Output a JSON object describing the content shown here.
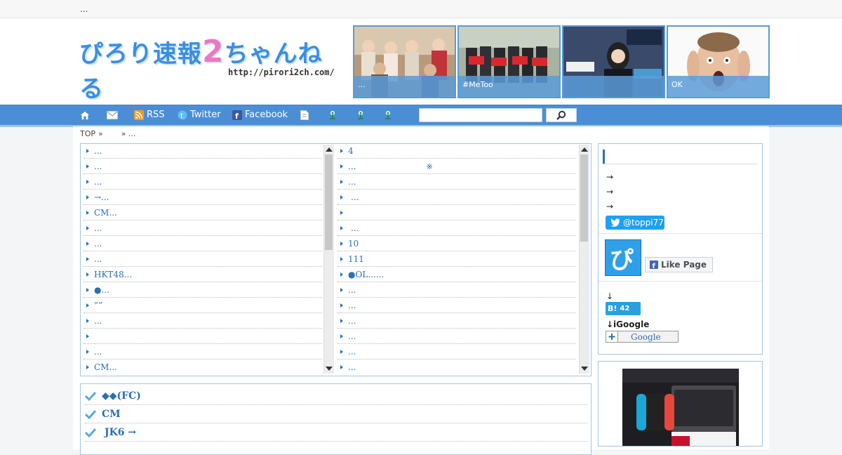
{
  "topbar": {
    "text": "..."
  },
  "header": {
    "logo_text_a": "ぴろり速報",
    "logo_text_2": "2",
    "logo_text_b": "ちゃんねる",
    "logo_url": "http://pirori2ch.com/"
  },
  "thumbs": [
    {
      "caption": "...",
      "icon": "tv-panel-photo"
    },
    {
      "caption": "#MeToo",
      "icon": "protest-photo"
    },
    {
      "caption": "",
      "icon": "news-anchor-photo"
    },
    {
      "caption": "OK",
      "icon": "shocked-man-photo"
    }
  ],
  "nav": {
    "home_icon": "home-icon",
    "mail_icon": "mail-icon",
    "rss": "RSS",
    "twitter": "Twitter",
    "facebook": "Facebook",
    "search_placeholder": ""
  },
  "breadcrumb": {
    "top": "TOP",
    "sep": "»",
    "current": "..."
  },
  "list_left": [
    "...",
    "...",
    "...",
    "→...",
    "CM...",
    "...",
    "...",
    "...",
    "HKT48...",
    "●...",
    "””",
    "...",
    "",
    "...",
    "CM..."
  ],
  "list_right": [
    "4",
    "...",
    "...",
    "...",
    "",
    "...",
    "10",
    "111",
    "●OL......",
    "...",
    "...",
    "...",
    "...",
    "...",
    "..."
  ],
  "list_right_mark": "※",
  "checks": [
    "◆◆(FC)",
    "CM",
    "JK6 →"
  ],
  "sidebar": {
    "arrows": [
      "→",
      "→",
      "→"
    ],
    "twitter_handle": "@toppi77",
    "fb_like": "Like Page",
    "hatena_arrow": "↓",
    "hatena_count": "42",
    "hatena_label": "B!",
    "igoogle": "↓iGoogle",
    "google_btn": "Google"
  },
  "colors": {
    "accent": "#4b8ed6",
    "link": "#2a6fb8",
    "pink": "#e879c5"
  }
}
